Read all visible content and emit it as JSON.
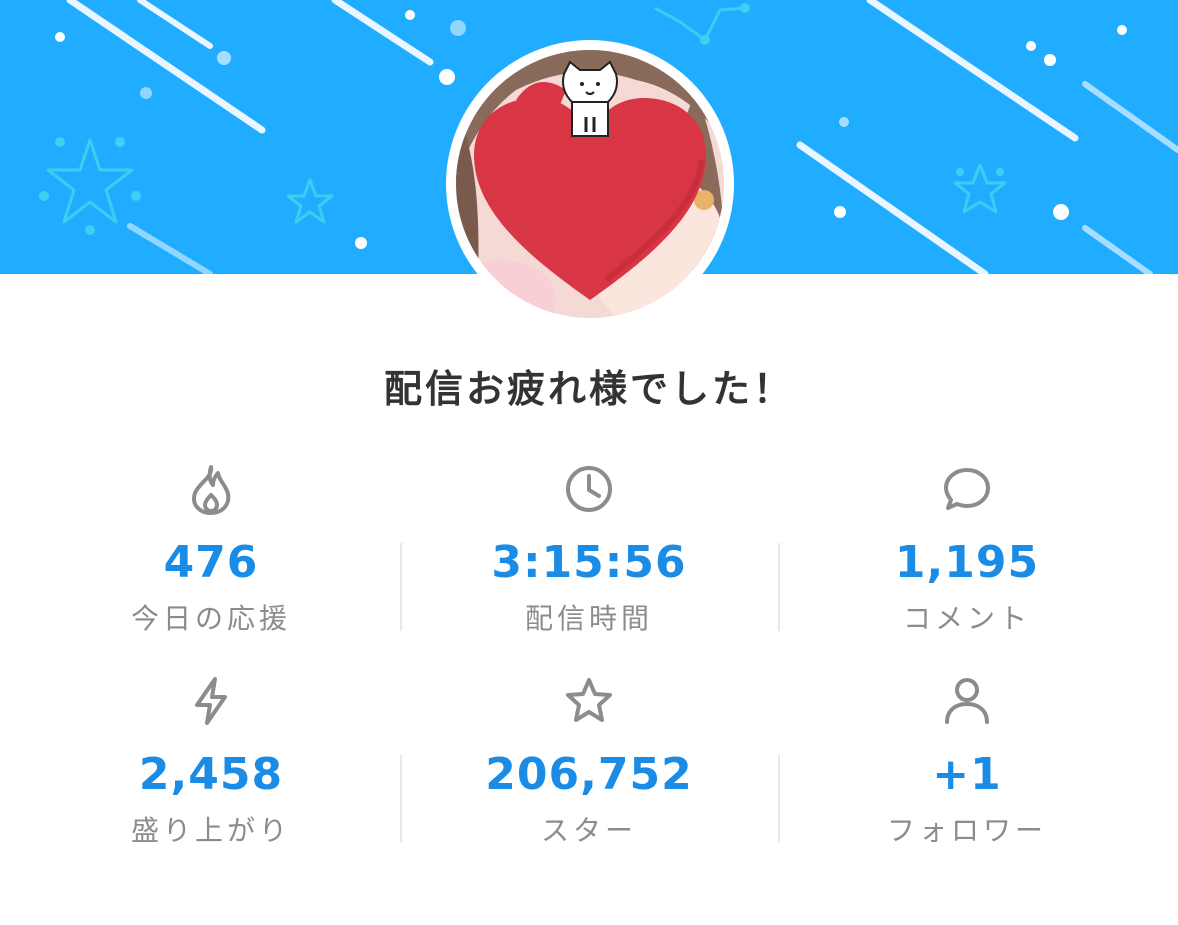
{
  "banner": {
    "background_color": "#21adff"
  },
  "avatar": {
    "heart_color": "#d93645"
  },
  "title": "配信お疲れ様でした！",
  "stats": [
    {
      "icon": "flame-icon",
      "value": "476",
      "label": "今日の応援"
    },
    {
      "icon": "clock-icon",
      "value": "3:15:56",
      "label": "配信時間"
    },
    {
      "icon": "comment-bubble-icon",
      "value": "1,195",
      "label": "コメント"
    },
    {
      "icon": "lightning-icon",
      "value": "2,458",
      "label": "盛り上がり"
    },
    {
      "icon": "star-icon",
      "value": "206,752",
      "label": "スター"
    },
    {
      "icon": "user-icon",
      "value": "+1",
      "label": "フォロワー"
    }
  ],
  "colors": {
    "value_text": "#1a8ce6",
    "label_text": "#8c8c8c",
    "icon_stroke": "#8c8c8c",
    "title_text": "#333333"
  }
}
